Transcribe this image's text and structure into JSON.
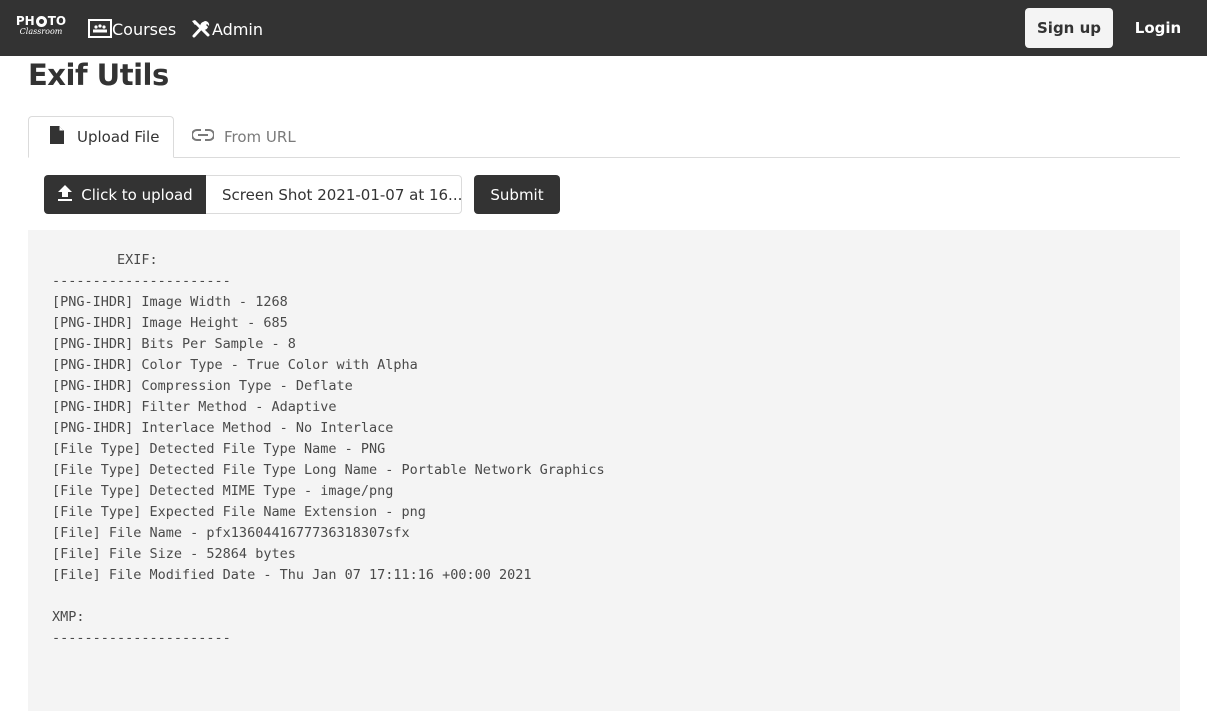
{
  "navbar": {
    "logo": {
      "top": "PHOTO",
      "bottom": "Classroom"
    },
    "links": [
      {
        "label": "Courses",
        "icon": "presentation-icon"
      },
      {
        "label": "Admin",
        "icon": "tools-icon"
      }
    ],
    "signup_label": "Sign up",
    "login_label": "Login"
  },
  "page": {
    "title": "Exif Utils"
  },
  "tabs": [
    {
      "label": "Upload File",
      "icon": "file-icon",
      "active": true
    },
    {
      "label": "From URL",
      "icon": "link-icon",
      "active": false
    }
  ],
  "upload": {
    "button_label": "Click to upload",
    "file_name": "Screen Shot 2021-01-07 at 16...",
    "submit_label": "Submit"
  },
  "output": {
    "lines": [
      "        EXIF:",
      "----------------------",
      "[PNG-IHDR] Image Width - 1268",
      "[PNG-IHDR] Image Height - 685",
      "[PNG-IHDR] Bits Per Sample - 8",
      "[PNG-IHDR] Color Type - True Color with Alpha",
      "[PNG-IHDR] Compression Type - Deflate",
      "[PNG-IHDR] Filter Method - Adaptive",
      "[PNG-IHDR] Interlace Method - No Interlace",
      "[File Type] Detected File Type Name - PNG",
      "[File Type] Detected File Type Long Name - Portable Network Graphics",
      "[File Type] Detected MIME Type - image/png",
      "[File Type] Expected File Name Extension - png",
      "[File] File Name - pfx1360441677736318307sfx",
      "[File] File Size - 52864 bytes",
      "[File] File Modified Date - Thu Jan 07 17:11:16 +00:00 2021",
      "",
      "XMP:",
      "----------------------"
    ]
  }
}
